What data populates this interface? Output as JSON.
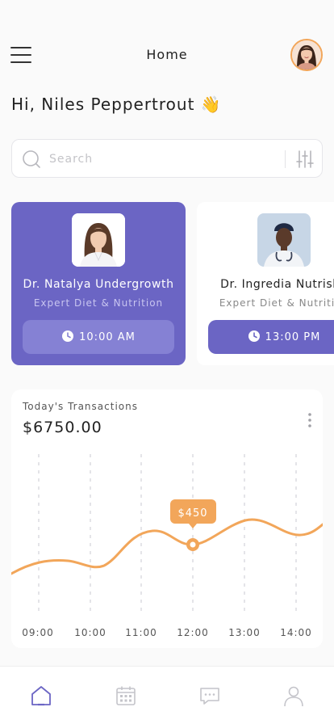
{
  "header": {
    "title": "Home"
  },
  "greeting": "Hi, Niles Peppertrout 👋",
  "search": {
    "placeholder": "Search"
  },
  "doctors": [
    {
      "name": "Dr. Natalya Undergrowth",
      "specialty": "Expert Diet & Nutrition",
      "time": "10:00 AM",
      "selected": true
    },
    {
      "name": "Dr. Ingredia Nutrisha",
      "specialty": "Expert Diet & Nutrition",
      "time": "13:00 PM",
      "selected": false
    }
  ],
  "transactions": {
    "label": "Today's Transactions",
    "amount": "$6750.00",
    "tooltip": "$450"
  },
  "chart_data": {
    "type": "line",
    "x": [
      "09:00",
      "10:00",
      "11:00",
      "12:00",
      "13:00",
      "14:00"
    ],
    "highlight": {
      "x": "12:00",
      "label": "$450"
    },
    "grid": "vertical-dashed",
    "color": "#f2a65a"
  },
  "tabs": [
    {
      "name": "home",
      "active": true
    },
    {
      "name": "calendar",
      "active": false
    },
    {
      "name": "messages",
      "active": false
    },
    {
      "name": "profile",
      "active": false
    }
  ],
  "colors": {
    "primary": "#6b65c4",
    "accent": "#f2a65a",
    "background": "#fafafa"
  }
}
